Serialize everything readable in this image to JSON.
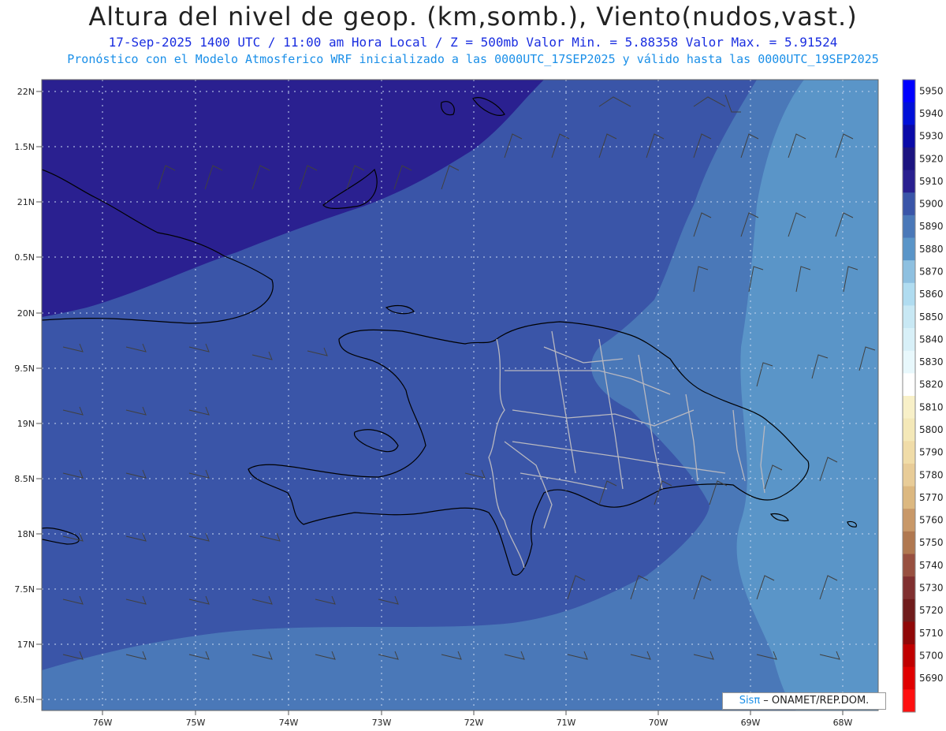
{
  "header": {
    "title": "Altura del nivel de geop. (km,somb.), Viento(nudos,vast.)",
    "subtitle": "17-Sep-2025  1400 UTC / 11:00 am Hora Local / Z = 500mb   Valor Min. = 5.88358  Valor Max. = 5.91524",
    "model_line": "Pronóstico con el Modelo Atmosferico WRF inicializado a las 0000UTC_17SEP2025 y válido hasta las  0000UTC_19SEP2025"
  },
  "axes": {
    "lat_labels": [
      "22N",
      "1.5N",
      "21N",
      "0.5N",
      "20N",
      "9.5N",
      "19N",
      "8.5N",
      "18N",
      "7.5N",
      "17N",
      "6.5N"
    ],
    "lon_labels": [
      "76W",
      "75W",
      "74W",
      "73W",
      "72W",
      "71W",
      "70W",
      "69W",
      "68W"
    ]
  },
  "colorbar": {
    "levels": [
      "5950",
      "5940",
      "5930",
      "5920",
      "5910",
      "5900",
      "5890",
      "5880",
      "5870",
      "5860",
      "5850",
      "5840",
      "5830",
      "5820",
      "5810",
      "5800",
      "5790",
      "5780",
      "5770",
      "5760",
      "5750",
      "5740",
      "5730",
      "5720",
      "5710",
      "5700",
      "5690"
    ],
    "colors": [
      "#0000ff",
      "#0010d8",
      "#0a0aa8",
      "#1c1480",
      "#2a2090",
      "#3a55a8",
      "#4a78b8",
      "#5a95c8",
      "#8ec0e0",
      "#b0dcf0",
      "#c8e8f4",
      "#d8f0f8",
      "#e8f8fc",
      "#ffffff",
      "#f8f0c8",
      "#f4e8b8",
      "#f0dca8",
      "#e8cc98",
      "#dcb880",
      "#c89868",
      "#b07850",
      "#985040",
      "#803030",
      "#701c1c",
      "#900808",
      "#c00000",
      "#e00000",
      "#ff1010"
    ]
  },
  "credit": {
    "sis": "Sisπ",
    "text": " – ONAMET/REP.DOM."
  }
}
